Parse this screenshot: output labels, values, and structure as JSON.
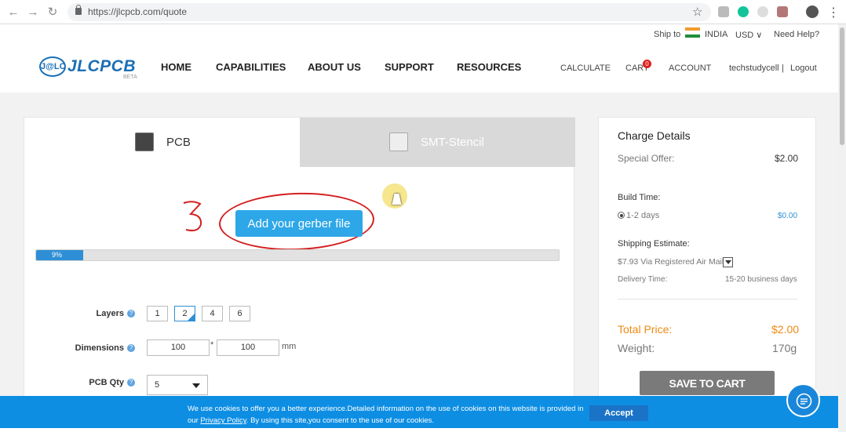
{
  "browser": {
    "url": "https://jlcpcb.com/quote",
    "back_icon": "arrow-left-icon",
    "forward_icon": "arrow-right-icon",
    "reload_icon": "reload-icon"
  },
  "topbar": {
    "ship_to_label": "Ship to",
    "country": "INDIA",
    "currency": "USD",
    "help": "Need Help?"
  },
  "logo": {
    "text": "JLCPCB",
    "mark": "J@LC",
    "beta": "BETA"
  },
  "nav": {
    "items": [
      "HOME",
      "CAPABILITIES",
      "ABOUT US",
      "SUPPORT",
      "RESOURCES"
    ],
    "calculate": "CALCULATE",
    "cart": "CART",
    "cart_count": "0",
    "account": "ACCOUNT",
    "username": "techstudycell",
    "separator": "|",
    "logout": "Logout"
  },
  "tabs": {
    "pcb": "PCB",
    "smt": "SMT-Stencil"
  },
  "upload": {
    "button": "Add your gerber file",
    "progress_percent": 9,
    "progress_label": "9%"
  },
  "form": {
    "layers_label": "Layers",
    "layers_options": [
      "1",
      "2",
      "4",
      "6"
    ],
    "layers_selected": "2",
    "dimensions_label": "Dimensions",
    "dim_x": "100",
    "dim_times": "*",
    "dim_y": "100",
    "dim_unit": "mm",
    "qty_label": "PCB Qty",
    "qty_value": "5"
  },
  "charge": {
    "title": "Charge Details",
    "special_offer_label": "Special Offer:",
    "special_offer_value": "$2.00",
    "build_time_label": "Build Time:",
    "build_option": "1-2 days",
    "build_price": "$0.00",
    "shipping_label": "Shipping Estimate:",
    "shipping_value": "$7.93 Via  Registered Air Mail",
    "delivery_label": "Delivery Time:",
    "delivery_value": "15-20 business days",
    "total_label": "Total Price:",
    "total_value": "$2.00",
    "weight_label": "Weight:",
    "weight_value": "170g",
    "save_button": "SAVE TO CART"
  },
  "cookie": {
    "text_before": "We use cookies to offer you a better experience.Detailed information on the use of cookies on this website is provided in our ",
    "link": "Privacy Policy",
    "text_after": ". By using this site,you consent to the use of our cookies.",
    "accept": "Accept"
  },
  "colors": {
    "brand": "#1a6fb5",
    "accent": "#2ea7e8",
    "cookie_bar": "#0d8ee3",
    "price_orange": "#f08a12",
    "annotation_red": "#d42020"
  }
}
